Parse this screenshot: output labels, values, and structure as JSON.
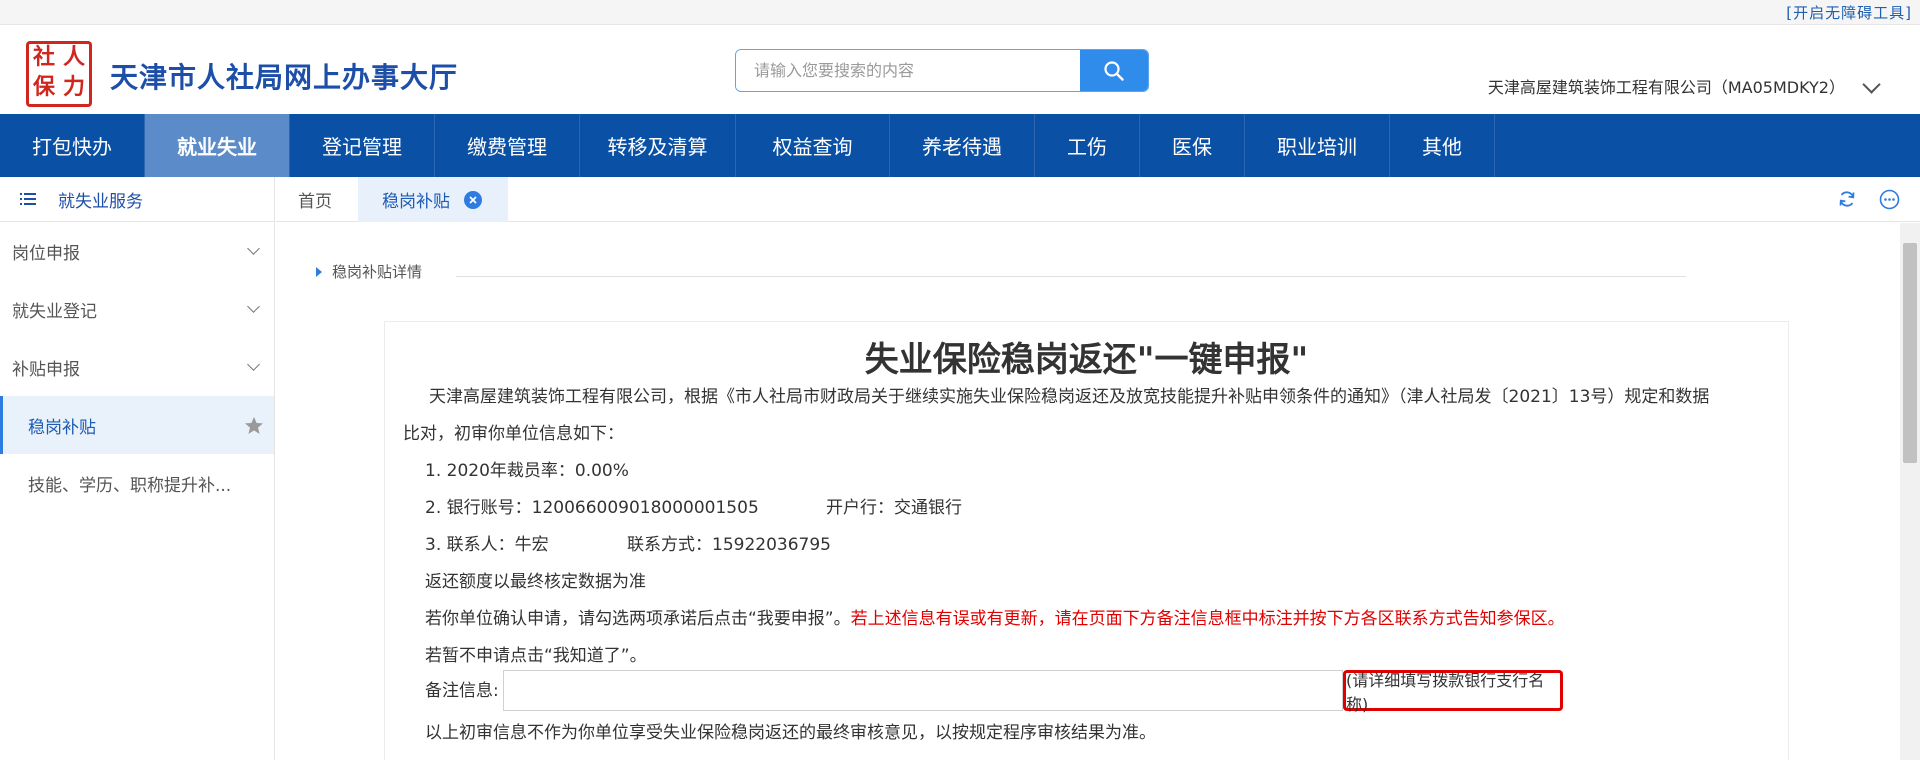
{
  "topbar": {
    "accessibility_link": "[开启无障碍工具]"
  },
  "header": {
    "logo_chars": [
      "社",
      "人",
      "保",
      "力"
    ],
    "site_title": "天津市人社局网上办事大厅",
    "search_placeholder": "请输入您要搜索的内容",
    "company": "天津高屋建筑装饰工程有限公司（MA05MDKY2）"
  },
  "nav": {
    "items": [
      {
        "label": "打包快办"
      },
      {
        "label": "就业失业"
      },
      {
        "label": "登记管理"
      },
      {
        "label": "缴费管理"
      },
      {
        "label": "转移及清算"
      },
      {
        "label": "权益查询"
      },
      {
        "label": "养老待遇"
      },
      {
        "label": "工伤"
      },
      {
        "label": "医保"
      },
      {
        "label": "职业培训"
      },
      {
        "label": "其他"
      }
    ],
    "active_label": "就业失业"
  },
  "sidebar": {
    "title": "就失业服务",
    "items": [
      {
        "label": "岗位申报"
      },
      {
        "label": "就失业登记"
      },
      {
        "label": "补贴申报"
      },
      {
        "label": "稳岗补贴"
      },
      {
        "label": "技能、学历、职称提升补..."
      }
    ]
  },
  "tabs": {
    "home": "首页",
    "current": "稳岗补贴"
  },
  "section": {
    "title": "稳岗补贴详情"
  },
  "doc": {
    "title": "失业保险稳岗返还\"一键申报\"",
    "intro_line1": "天津高屋建筑装饰工程有限公司，根据《市人社局市财政局关于继续实施失业保险稳岗返还及放宽技能提升补贴申领条件的通知》（津人社局发〔2021〕13号）规定和数据",
    "intro_line2": "比对，初审你单位信息如下：",
    "item1": "1. 2020年裁员率：0.00%",
    "item2_account": "2. 银行账号：12006600901800000​1505",
    "item2_bank": "开户行：交通银行",
    "item3_contact": "3. 联系人：牛宏",
    "item3_phone": "联系方式：15922036795",
    "note_final": "返还额度以最终核定数据为准",
    "confirm_text": "若你单位确认申请，请勾选两项承诺后点击“我要申报”。",
    "confirm_warning": "若上述信息有误或有更新，请在页面下方备注信息框中标注并按下方各区联系方式告知参保区。",
    "decline_text": "若暂不申请点击“我知道了”。",
    "remark_label": "备注信息:",
    "remark_value": "",
    "remark_hint": "(请详细填写拨款银行支行名称)",
    "disclaimer": "以上初审信息不作为你单位享受失业保险稳岗返还的最终审核意见，以按规定程序审核结果为准。"
  },
  "colors": {
    "nav_bg": "#0a50a4",
    "nav_active": "#5b8cc9",
    "accent": "#2f7ce0",
    "warning": "#e00000"
  }
}
